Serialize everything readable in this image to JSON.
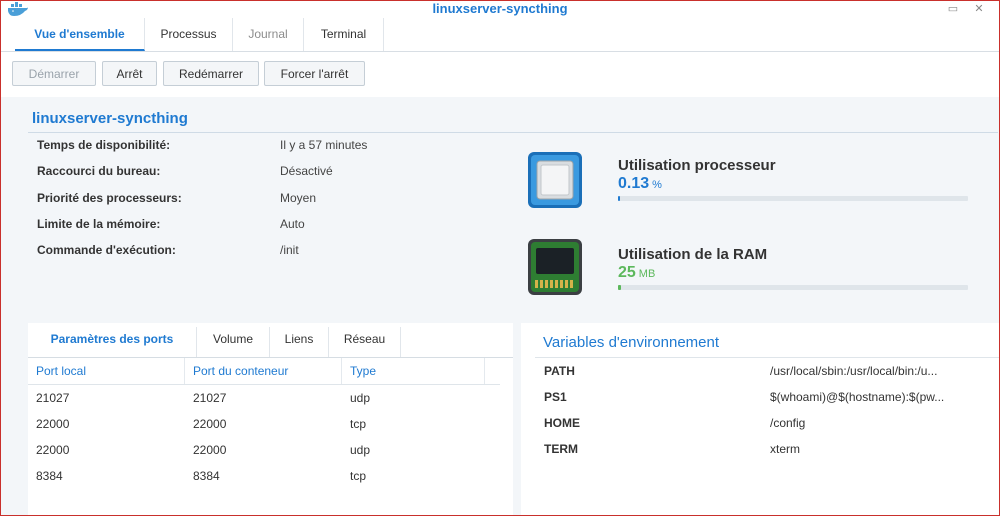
{
  "window": {
    "title": "linuxserver-syncthing",
    "minimize_glyph": "▭",
    "close_glyph": "✕",
    "icon": "docker-whale-icon"
  },
  "tabs": [
    {
      "label": "Vue d'ensemble",
      "active": true
    },
    {
      "label": "Processus"
    },
    {
      "label": "Journal",
      "disabled": true
    },
    {
      "label": "Terminal"
    }
  ],
  "toolbar": {
    "start_label": "Démarrer",
    "stop_label": "Arrêt",
    "restart_label": "Redémarrer",
    "force_stop_label": "Forcer l'arrêt"
  },
  "overview": {
    "title": "linuxserver-syncthing",
    "rows": [
      {
        "label": "Temps de disponibilité:",
        "value": "Il y a 57 minutes"
      },
      {
        "label": "Raccourci du bureau:",
        "value": "Désactivé"
      },
      {
        "label": "Priorité des processeurs:",
        "value": "Moyen"
      },
      {
        "label": "Limite de la mémoire:",
        "value": "Auto"
      },
      {
        "label": "Commande d'exécution:",
        "value": "/init"
      }
    ]
  },
  "resources": {
    "cpu": {
      "title": "Utilisation processeur",
      "value": "0.13",
      "unit": "%",
      "fraction": 0.0013,
      "color": "#1f7ad1",
      "icon": "cpu-icon"
    },
    "ram": {
      "title": "Utilisation de la RAM",
      "value": "25",
      "unit": "MB",
      "fraction": 0.008,
      "color": "#5cb85c",
      "icon": "ram-chip-icon"
    }
  },
  "ports": {
    "subtabs": [
      {
        "label": "Paramètres des ports",
        "active": true
      },
      {
        "label": "Volume"
      },
      {
        "label": "Liens"
      },
      {
        "label": "Réseau"
      }
    ],
    "headers": {
      "local": "Port local",
      "container": "Port du conteneur",
      "type": "Type"
    },
    "rows": [
      {
        "local": "21027",
        "container": "21027",
        "type": "udp"
      },
      {
        "local": "22000",
        "container": "22000",
        "type": "tcp"
      },
      {
        "local": "22000",
        "container": "22000",
        "type": "udp"
      },
      {
        "local": "8384",
        "container": "8384",
        "type": "tcp"
      }
    ]
  },
  "env": {
    "title": "Variables d'environnement",
    "rows": [
      {
        "key": "PATH",
        "value": "/usr/local/sbin:/usr/local/bin:/u..."
      },
      {
        "key": "PS1",
        "value": "$(whoami)@$(hostname):$(pw..."
      },
      {
        "key": "HOME",
        "value": "/config"
      },
      {
        "key": "TERM",
        "value": "xterm"
      }
    ]
  },
  "colors": {
    "accent": "#1f7ad1",
    "ram": "#5cb85c"
  }
}
